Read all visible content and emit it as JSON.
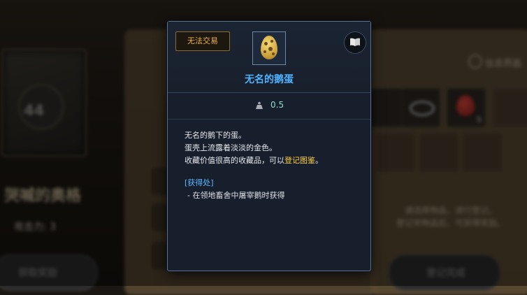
{
  "background": {
    "left_level": "44",
    "left_name": "哭喊的奥格",
    "left_attack": "攻击力: 3",
    "left_button": "获取奖励",
    "info_toggle_label": "信息界面",
    "right_hint_line1": "请选择物品，进行登记。",
    "right_hint_line2": "登记完物品后，可获得奖励。",
    "right_button": "登记完成",
    "strawberry_count": "5"
  },
  "tooltip": {
    "trade_tag": "无法交易",
    "item_name": "无名的鹅蛋",
    "weight_value": "0.5",
    "description_line1": "无名的鹅下的蛋。",
    "description_line2": "蛋壳上流露着淡淡的金色。",
    "description_line3_prefix": "收藏价值很高的收藏品，可以",
    "description_line3_highlight": "登记图鉴",
    "description_line3_suffix": "。",
    "source_title": "[获得处]",
    "source_line": "- 在领地畜舍中屠宰鹅时获得",
    "book_icon": "book-icon",
    "colors": {
      "item_name": "#4fb2ff",
      "trade_tag": "#f0b23a",
      "highlight": "#ffcf3a",
      "weight": "#8fdccc"
    }
  }
}
